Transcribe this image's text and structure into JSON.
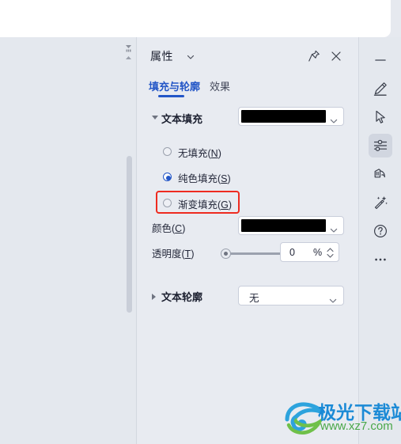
{
  "colors": {
    "accent": "#2356c7",
    "panel_bg": "#e8ebf1",
    "workspace_bg": "#e4e8ee",
    "annotation_red": "#ee2b20",
    "fill_swatch": "#000000",
    "color_swatch": "#000000",
    "watermark_blue": "#1b8ad6",
    "watermark_green": "#4aa84a"
  },
  "panel": {
    "title": "属性",
    "title_caret_icon": "chevron-down-icon",
    "pin_icon": "pin-icon",
    "close_icon": "close-icon",
    "tabs": [
      {
        "label": "填充与轮廓",
        "active": true
      },
      {
        "label": "效果",
        "active": false
      }
    ],
    "sections": {
      "text_fill": {
        "label": "文本填充",
        "expanded": true,
        "expander_icon": "triangle-down-icon",
        "swatch_color": "#000000",
        "swatch_caret_icon": "chevron-down-icon",
        "radios": [
          {
            "label_main": "无填充(",
            "label_key": "N",
            "label_tail": ")",
            "checked": false
          },
          {
            "label_main": "纯色填充(",
            "label_key": "S",
            "label_tail": ")",
            "checked": true
          },
          {
            "label_main": "渐变填充(",
            "label_key": "G",
            "label_tail": ")",
            "checked": false
          }
        ],
        "color_row": {
          "label_main": "颜色(",
          "label_key": "C",
          "label_tail": ")",
          "swatch_color": "#000000",
          "caret_icon": "chevron-down-icon"
        },
        "transparency_row": {
          "label_main": "透明度(",
          "label_key": "T",
          "label_tail": ")",
          "value": "0",
          "unit": "%",
          "slider_percent": 0,
          "stepper_icon": "spinner-arrows-icon"
        }
      },
      "text_outline": {
        "label": "文本轮廓",
        "expanded": false,
        "expander_icon": "triangle-right-icon",
        "dropdown_value": "无",
        "dropdown_caret_icon": "chevron-down-icon"
      }
    }
  },
  "workspace": {
    "collapse_down_icon": "collapse-down-handle-icon",
    "collapse_up_icon": "collapse-up-handle-icon",
    "scrollbar_icon": "vertical-scrollbar-thumb"
  },
  "rail": {
    "items": [
      {
        "name": "minimize-rail-icon",
        "icon": "minus-icon",
        "selected": false
      },
      {
        "name": "pen-rail-icon",
        "icon": "pen-icon",
        "selected": false
      },
      {
        "name": "select-rail-icon",
        "icon": "cursor-arrow-icon",
        "selected": false
      },
      {
        "name": "properties-rail-icon",
        "icon": "sliders-icon",
        "selected": true
      },
      {
        "name": "eraser-rail-icon",
        "icon": "eraser-icon",
        "selected": false
      },
      {
        "name": "effects-rail-icon",
        "icon": "magic-wand-icon",
        "selected": false
      },
      {
        "name": "help-rail-icon",
        "icon": "question-circle-icon",
        "selected": false
      },
      {
        "name": "more-rail-icon",
        "icon": "ellipsis-icon",
        "selected": false
      }
    ]
  },
  "watermark": {
    "title": "极光下载站",
    "url": "www.xz7.com",
    "logo_icon": "aurora-swirl-logo-icon"
  }
}
